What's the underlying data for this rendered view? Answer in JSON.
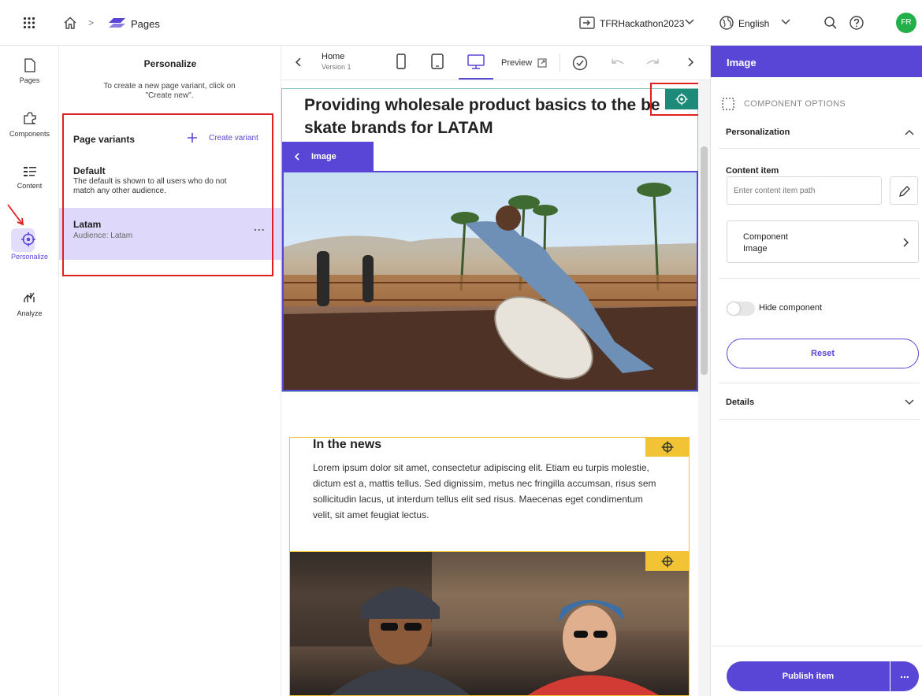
{
  "topbar": {
    "breadcrumb_sep": ">",
    "app_name": "Pages",
    "site_name": "TFRHackathon2023",
    "language": "English",
    "avatar_initials": "FR"
  },
  "leftnav": {
    "items": [
      {
        "label": "Pages"
      },
      {
        "label": "Components"
      },
      {
        "label": "Content"
      },
      {
        "label": "Personalize"
      },
      {
        "label": "Analyze"
      }
    ]
  },
  "panel": {
    "title": "Personalize",
    "hint": "To create a new page variant, click on \"Create new\".",
    "variants_heading": "Page variants",
    "create_label": "Create variant",
    "variants": [
      {
        "name": "Default",
        "description": "The default is shown to all users who do not match any other audience."
      },
      {
        "name": "Latam",
        "description": "Audience: Latam"
      }
    ],
    "more": "..."
  },
  "toolbar": {
    "page_name": "Home",
    "version": "Version 1",
    "preview_label": "Preview"
  },
  "canvas": {
    "headline": "Providing wholesale product basics to the be skate brands for LATAM",
    "image_tab": "Image",
    "news_title": "In the news",
    "news_body": "Lorem ipsum dolor sit amet, consectetur adipiscing elit. Etiam eu turpis molestie, dictum est a, mattis tellus. Sed dignissim, metus nec fringilla accumsan, risus sem sollicitudin lacus, ut interdum tellus elit sed risus. Maecenas eget condimentum velit, sit amet feugiat lectus."
  },
  "right": {
    "header": "Image",
    "section_label": "COMPONENT OPTIONS",
    "personalization": "Personalization",
    "content_item_label": "Content item",
    "content_item_placeholder": "Enter content item path",
    "component_label": "Component",
    "component_value": "Image",
    "hide_label": "Hide component",
    "reset_label": "Reset",
    "details_label": "Details",
    "publish_label": "Publish item",
    "publish_more": "..."
  },
  "colors": {
    "accent": "#5a46d6",
    "highlight": "#ded9fa",
    "marker_green": "#1e8a7a",
    "marker_yellow": "#f2c335",
    "annotation_red": "#e02020",
    "avatar": "#23b04b"
  }
}
